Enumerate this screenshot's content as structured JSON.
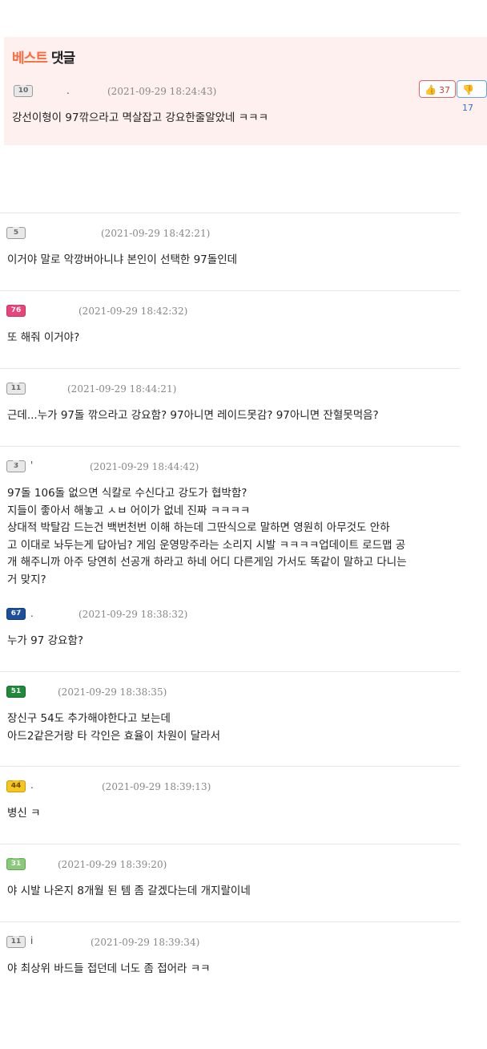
{
  "best": {
    "title_accent": "베스트",
    "title_rest": "댓글",
    "comment": {
      "level": "10",
      "nick": ".",
      "date": "(2021-09-29 18:24:43)",
      "text": "강선이형이 97깎으라고 멱살잡고 강요한줄알았네 ㅋㅋㅋ",
      "upvotes": "37",
      "downvotes": "17",
      "up_icon": "thumbs-up-icon",
      "down_icon": "thumbs-down-icon"
    }
  },
  "comments": [
    {
      "level": "5",
      "nick": "",
      "date": "(2021-09-29 18:42:21)",
      "lines": [
        "이거야 말로 악깡버아니냐 본인이 선택한 97돌인데"
      ]
    },
    {
      "level": "76",
      "nick": "",
      "date": "(2021-09-29 18:42:32)",
      "lines": [
        "또 해줘 이거야?"
      ]
    },
    {
      "level": "11",
      "nick": "",
      "date": "(2021-09-29 18:44:21)",
      "lines": [
        "근데...누가 97돌 깎으라고 강요함? 97아니면 레이드못감? 97아니면 잔혈못먹음?"
      ]
    },
    {
      "level": "3",
      "nick": "'",
      "date": "(2021-09-29 18:44:42)",
      "lines": [
        "97돌 106돌 없으면 식칼로 수신다고 강도가 협박함?",
        "지들이 좋아서 해놓고 ㅅㅂ 어이가 없네 진짜 ㅋㅋㅋㅋ",
        "상대적 박탈감 드는건 백번천번 이해 하는데 그딴식으로 말하면 영원히 아무것도 안하",
        "고 이대로 놔두는게 답아님? 게임 운영망주라는 소리지 시발 ㅋㅋㅋㅋ업데이트 로드맵 공",
        "개 해주니까 아주 당연히 선공개 하라고 하네 어디 다른게임 가서도 똑같이 말하고 다니는",
        "거 맞지?"
      ]
    },
    {
      "level": "67",
      "nick": ".",
      "date": "(2021-09-29 18:38:32)",
      "lines": [
        "누가 97 강요함?"
      ]
    },
    {
      "level": "51",
      "nick": "",
      "date": "(2021-09-29 18:38:35)",
      "lines": [
        "장신구 54도 추가해야한다고 보는데",
        "아드2같은거랑 타 각인은 효율이 차원이 달라서"
      ]
    },
    {
      "level": "44",
      "nick": ".",
      "date": "(2021-09-29 18:39:13)",
      "lines": [
        "병신 ㅋ"
      ]
    },
    {
      "level": "31",
      "nick": "",
      "date": "(2021-09-29 18:39:20)",
      "lines": [
        "야 시발 나온지 8개월 된 템 좀 갈겠다는데 개지랄이네"
      ]
    },
    {
      "level": "11",
      "nick": "i",
      "date": "(2021-09-29 18:39:34)",
      "lines": [
        "야 최상위 바드들 접던데 너도 좀 접어라 ㅋㅋ"
      ]
    }
  ],
  "colors": {
    "best_bg": "#fdf0ee",
    "accent": "#ff6b3d",
    "separator": "#e6e6e6",
    "date": "#888888"
  }
}
